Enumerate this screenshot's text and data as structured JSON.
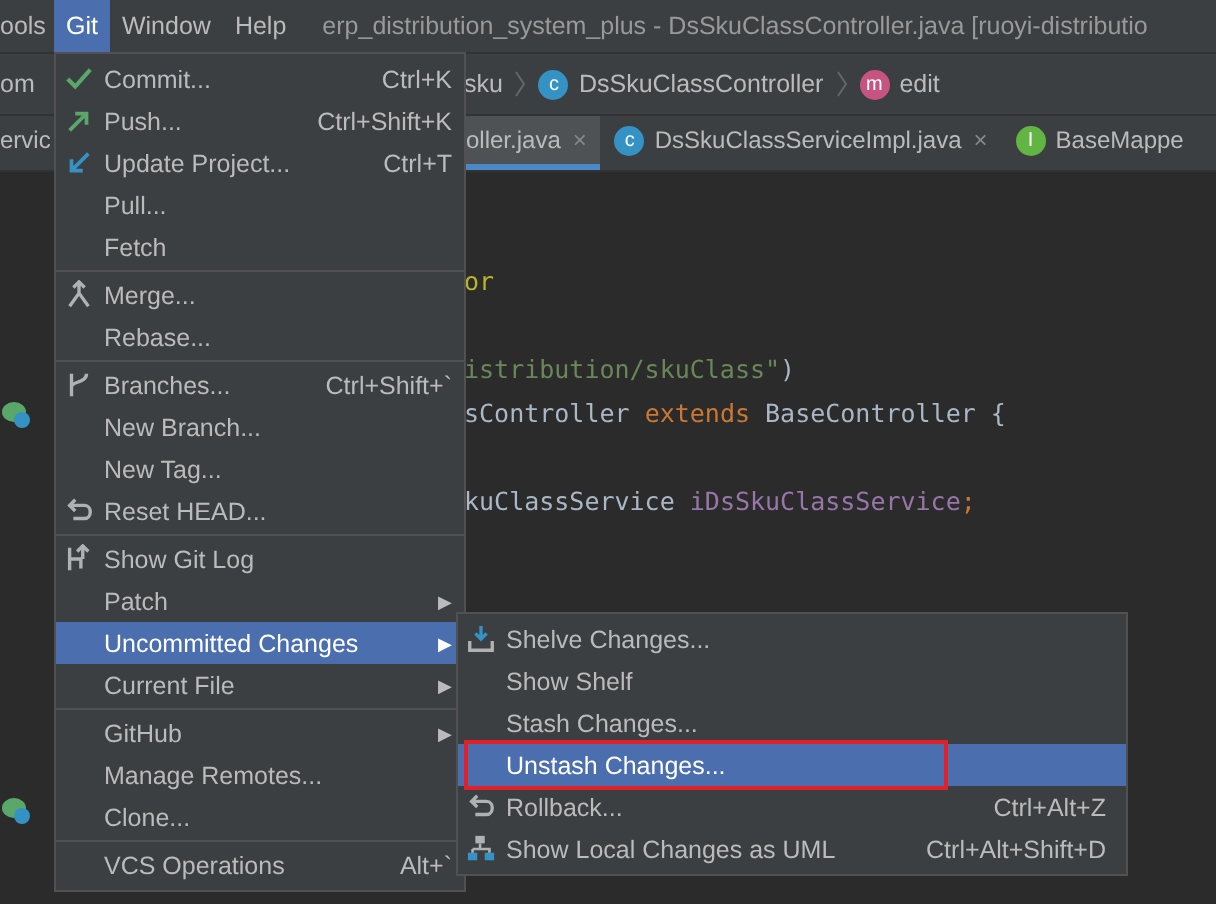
{
  "menubar": [
    {
      "label": "ools",
      "selected": false
    },
    {
      "label": "Git",
      "selected": true
    },
    {
      "label": "Window",
      "selected": false
    },
    {
      "label": "Help",
      "selected": false
    }
  ],
  "window": {
    "title": "erp_distribution_system_plus - DsSkuClassController.java [ruoyi-distributio"
  },
  "breadcrumbs": [
    {
      "label": "om"
    },
    {
      "label": "sku"
    },
    {
      "label": "DsSkuClassController",
      "kind": "class",
      "badge": "c"
    },
    {
      "label": "edit",
      "kind": "method",
      "badge": "m"
    }
  ],
  "tabs": [
    {
      "label": "ervic",
      "selected": false
    },
    {
      "label": "oller.java",
      "selected": true,
      "close": "×"
    },
    {
      "label": "DsSkuClassServiceImpl.java",
      "kind": "class",
      "badge": "c",
      "selected": false,
      "close": "×"
    },
    {
      "label": "BaseMappe",
      "kind": "interface",
      "badge": "I",
      "selected": false
    }
  ],
  "code": {
    "lines": [
      {
        "blank": true
      },
      {
        "blank": true
      },
      {
        "blank": false,
        "tokens": [
          {
            "text": "or",
            "kind": "annotation"
          }
        ]
      },
      {
        "blank": true
      },
      {
        "blank": false,
        "tokens": [
          {
            "text": "istribution/skuClass\"",
            "kind": "string"
          },
          {
            "text": ")",
            "kind": "plain"
          }
        ]
      },
      {
        "blank": false,
        "tokens": [
          {
            "text": "sController ",
            "kind": "plain"
          },
          {
            "text": "extends ",
            "kind": "keyword"
          },
          {
            "text": "BaseController {",
            "kind": "plain"
          }
        ]
      },
      {
        "blank": true
      },
      {
        "blank": false,
        "tokens": [
          {
            "text": "kuClassService ",
            "kind": "plain"
          },
          {
            "text": "iDsSkuClassService",
            "kind": "field"
          },
          {
            "text": ";",
            "kind": "keyword"
          }
        ]
      }
    ]
  },
  "git_menu": {
    "groups": [
      [
        {
          "label": "Commit...",
          "shortcut": "Ctrl+K",
          "selected": false
        },
        {
          "label": "Push...",
          "shortcut": "Ctrl+Shift+K",
          "selected": false
        },
        {
          "label": "Update Project...",
          "shortcut": "Ctrl+T",
          "selected": false
        },
        {
          "label": "Pull...",
          "selected": false
        },
        {
          "label": "Fetch",
          "selected": false
        }
      ],
      [
        {
          "label": "Merge...",
          "selected": false
        },
        {
          "label": "Rebase...",
          "selected": false
        }
      ],
      [
        {
          "label": "Branches...",
          "shortcut": "Ctrl+Shift+`",
          "selected": false
        },
        {
          "label": "New Branch...",
          "selected": false
        },
        {
          "label": "New Tag...",
          "selected": false
        },
        {
          "label": "Reset HEAD...",
          "selected": false
        }
      ],
      [
        {
          "label": "Show Git Log",
          "selected": false
        },
        {
          "label": "Patch",
          "arrow": "▶",
          "selected": false
        },
        {
          "label": "Uncommitted Changes",
          "arrow": "▶",
          "selected": true
        },
        {
          "label": "Current File",
          "arrow": "▶",
          "selected": false
        }
      ],
      [
        {
          "label": "GitHub",
          "arrow": "▶",
          "selected": false
        },
        {
          "label": "Manage Remotes...",
          "selected": false
        },
        {
          "label": "Clone...",
          "selected": false
        }
      ],
      [
        {
          "label": "VCS Operations",
          "shortcut": "Alt+`",
          "selected": false
        }
      ]
    ]
  },
  "submenu": {
    "items": [
      {
        "label": "Shelve Changes...",
        "selected": false,
        "annotated": false
      },
      {
        "label": "Show Shelf",
        "selected": false,
        "annotated": false
      },
      {
        "label": "Stash Changes...",
        "selected": false,
        "annotated": false
      },
      {
        "label": "Unstash Changes...",
        "selected": true,
        "annotated": true
      },
      {
        "label": "Rollback...",
        "shortcut": "Ctrl+Alt+Z",
        "selected": false,
        "annotated": false
      },
      {
        "label": "Show Local Changes as UML",
        "shortcut": "Ctrl+Alt+Shift+D",
        "selected": false,
        "annotated": false
      }
    ]
  }
}
